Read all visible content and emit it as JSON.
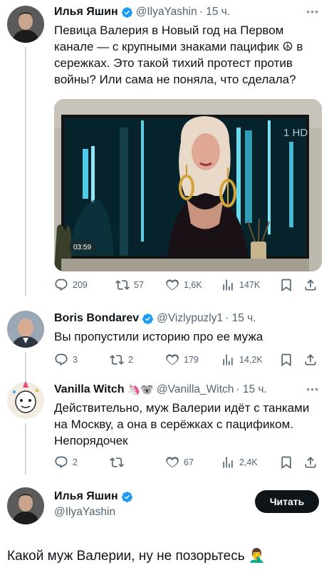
{
  "tweets": [
    {
      "name": "Илья Яшин",
      "handle": "@IlyaYashin",
      "time": "· 15 ч.",
      "text": "Певица Валерия в Новый год на Первом канале — с крупными знаками пацифик ☮ в сережках. Это такой тихий протест против войны? Или сама не поняла, что сделала?",
      "media": {
        "channel_logo": "1 HD",
        "clock": "03:59"
      },
      "stats": {
        "replies": "209",
        "reposts": "57",
        "likes": "1,6K",
        "views": "147K"
      }
    },
    {
      "name": "Boris Bondarev",
      "handle": "@Vizlypuzly1",
      "time": "· 15 ч.",
      "text": "Вы пропустили историю про ее мужа",
      "stats": {
        "replies": "3",
        "reposts": "2",
        "likes": "179",
        "views": "14,2K"
      }
    },
    {
      "name": "Vanilla Witch",
      "name_emoji": "🦄🐨",
      "handle": "@Vanilla_Witch",
      "time": "· 15 ч.",
      "text": "Действительно, муж Валерии идёт с танками на Москву, а она в серёжках с пацификом. Непорядочек",
      "stats": {
        "replies": "2",
        "reposts": "",
        "likes": "67",
        "views": "2,4K"
      }
    }
  ],
  "profile": {
    "name": "Илья Яшин",
    "handle": "@IlyaYashin",
    "button": "Читать"
  },
  "caption": "Какой муж Валерии, ну не позорьтесь 🤦‍♂️",
  "colors": {
    "verified": "#1d9bf0",
    "text": "#0f1419",
    "muted": "#536471",
    "button_bg": "#0f1419"
  }
}
